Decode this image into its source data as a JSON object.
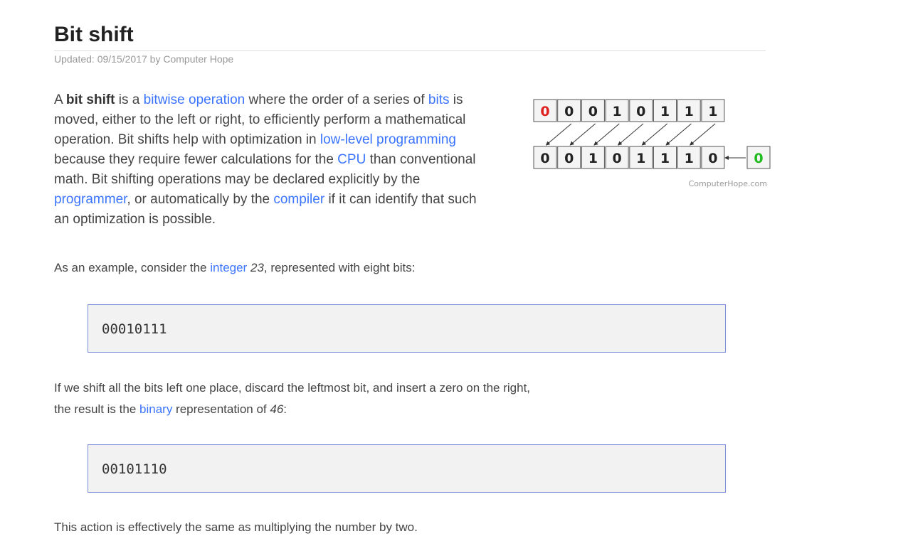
{
  "article": {
    "title": "Bit shift",
    "meta": {
      "prefix": "Updated: ",
      "date": "09/15/2017",
      "by": " by ",
      "author": "Computer Hope"
    },
    "intro": {
      "t1": "A ",
      "term": "bit shift",
      "t2": " is a ",
      "link_bitwise": "bitwise operation",
      "t3": " where the order of a series of ",
      "link_bits": "bits",
      "t4": " is moved, either to the left or right, to efficiently perform a mathematical operation. Bit shifts help with optimization in ",
      "link_lowlevel": "low-level programming",
      "t5": " because they require fewer calculations for the ",
      "link_cpu": "CPU",
      "t6": " than conventional math. Bit shifting operations may be declared explicitly by the ",
      "link_programmer": "programmer",
      "t7": ", or automatically by the ",
      "link_compiler": "compiler",
      "t8": " if it can identify that such an optimization is possible."
    },
    "example": {
      "t1": "As an example, consider the ",
      "link_integer": "integer",
      "t2": " ",
      "number": "23",
      "t3": ", represented with eight bits:"
    },
    "code1": "00010111",
    "shift_text": {
      "t1": "If we shift all the bits left one place, discard the leftmost bit, and insert a zero on the right, the result is the ",
      "link_binary": "binary",
      "t2": " representation of ",
      "number": "46",
      "t3": ":"
    },
    "code2": "00101110",
    "conclusion": "This action is effectively the same as multiplying the number by two."
  },
  "diagram": {
    "top_bits": [
      "0",
      "0",
      "0",
      "1",
      "0",
      "1",
      "1",
      "1"
    ],
    "bottom_bits": [
      "0",
      "0",
      "1",
      "0",
      "1",
      "1",
      "1",
      "0"
    ],
    "inserted_bit": "0",
    "watermark": "ComputerHope.com",
    "colors": {
      "discarded": "#e0201e",
      "inserted": "#1fbb1f",
      "box_fill": "#f4f4f4",
      "box_border": "#555555"
    }
  },
  "colors": {
    "link": "#3a74ff",
    "text": "#444444",
    "code_border": "#7a8bd8",
    "code_bg": "#f2f2f2"
  }
}
